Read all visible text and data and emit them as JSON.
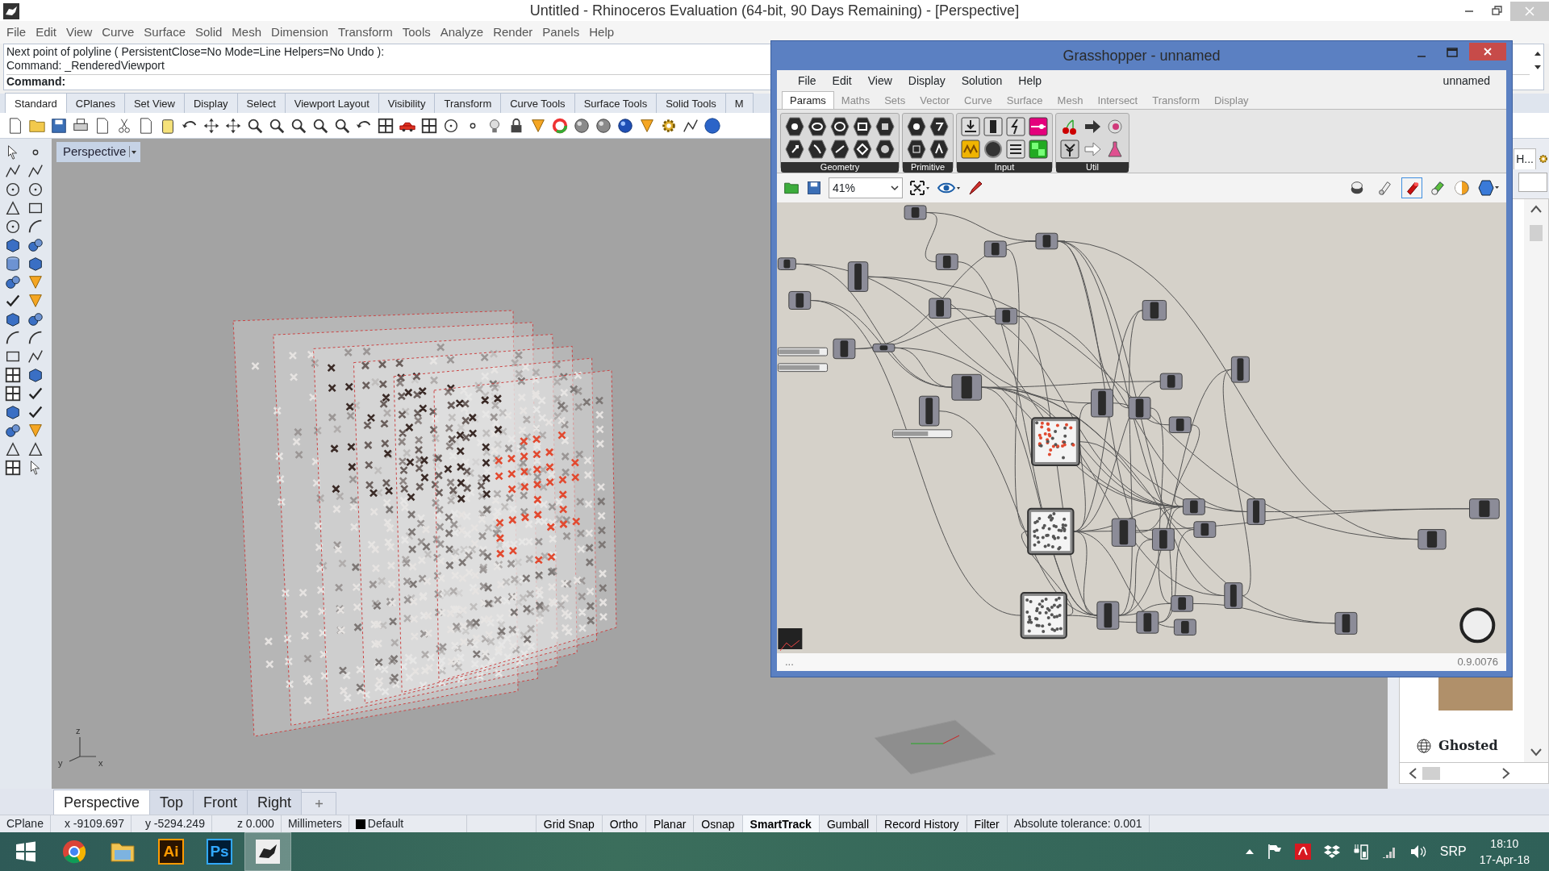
{
  "window": {
    "title": "Untitled - Rhinoceros Evaluation (64-bit, 90 Days Remaining) - [Perspective]"
  },
  "menu": [
    "File",
    "Edit",
    "View",
    "Curve",
    "Surface",
    "Solid",
    "Mesh",
    "Dimension",
    "Transform",
    "Tools",
    "Analyze",
    "Render",
    "Panels",
    "Help"
  ],
  "command_history": [
    "Next point of polyline ( PersistentClose=No  Mode=Line  Helpers=No  Undo ):",
    "Command: _RenderedViewport"
  ],
  "command_prompt": "Command:",
  "toolbar_tabs": [
    {
      "label": "Standard",
      "selected": true
    },
    {
      "label": "CPlanes",
      "selected": false
    },
    {
      "label": "Set View",
      "selected": false
    },
    {
      "label": "Display",
      "selected": false
    },
    {
      "label": "Select",
      "selected": false
    },
    {
      "label": "Viewport Layout",
      "selected": false
    },
    {
      "label": "Visibility",
      "selected": false
    },
    {
      "label": "Transform",
      "selected": false
    },
    {
      "label": "Curve Tools",
      "selected": false
    },
    {
      "label": "Surface Tools",
      "selected": false
    },
    {
      "label": "Solid Tools",
      "selected": false
    },
    {
      "label": "M",
      "selected": false
    }
  ],
  "viewport": {
    "label": "Perspective",
    "axis_labels": [
      "z",
      "y",
      "x"
    ]
  },
  "viewport_tabs": [
    {
      "label": "Perspective",
      "selected": true
    },
    {
      "label": "Top",
      "selected": false
    },
    {
      "label": "Front",
      "selected": false
    },
    {
      "label": "Right",
      "selected": false
    }
  ],
  "status_bar": {
    "cplane": "CPlane",
    "x": "x -9109.697",
    "y": "y -5294.249",
    "z": "z 0.000",
    "units": "Millimeters",
    "layer": "Default",
    "toggles": [
      {
        "label": "Grid Snap",
        "on": false
      },
      {
        "label": "Ortho",
        "on": false
      },
      {
        "label": "Planar",
        "on": false
      },
      {
        "label": "Osnap",
        "on": false
      },
      {
        "label": "SmartTrack",
        "on": true
      },
      {
        "label": "Gumball",
        "on": false
      },
      {
        "label": "Record History",
        "on": false
      },
      {
        "label": "Filter",
        "on": false
      }
    ],
    "tolerance": "Absolute tolerance: 0.001"
  },
  "side_panel": {
    "tab": "H...",
    "display_mode": "Ghosted"
  },
  "grasshopper": {
    "title": "Grasshopper - unnamed",
    "menu": [
      "File",
      "Edit",
      "View",
      "Display",
      "Solution",
      "Help"
    ],
    "document_name": "unnamed",
    "tabs": [
      {
        "label": "Params",
        "selected": true
      },
      {
        "label": "Maths",
        "selected": false
      },
      {
        "label": "Sets",
        "selected": false
      },
      {
        "label": "Vector",
        "selected": false
      },
      {
        "label": "Curve",
        "selected": false
      },
      {
        "label": "Surface",
        "selected": false
      },
      {
        "label": "Mesh",
        "selected": false
      },
      {
        "label": "Intersect",
        "selected": false
      },
      {
        "label": "Transform",
        "selected": false
      },
      {
        "label": "Display",
        "selected": false
      }
    ],
    "panels": [
      {
        "label": "Geometry"
      },
      {
        "label": "Primitive"
      },
      {
        "label": "Input"
      },
      {
        "label": "Util"
      }
    ],
    "zoom": "41%",
    "sliders": [
      {
        "level": 0.85
      },
      {
        "level": 0.85
      },
      {
        "level": 0.6
      }
    ],
    "preview_modes": [
      {
        "selected": false
      },
      {
        "selected": false
      },
      {
        "selected": true
      }
    ],
    "status_left": "...",
    "version": "0.9.0076"
  },
  "taskbar": {
    "apps": [
      {
        "kind": "windows",
        "selected": false
      },
      {
        "kind": "browser",
        "selected": false
      },
      {
        "kind": "folder",
        "selected": false
      },
      {
        "kind": "ai",
        "label": "Ai",
        "selected": false
      },
      {
        "kind": "ps",
        "label": "Ps",
        "selected": false
      },
      {
        "kind": "rhino",
        "selected": true
      }
    ],
    "language": "SRP",
    "time": "18:10",
    "date": "17-Apr-18"
  }
}
